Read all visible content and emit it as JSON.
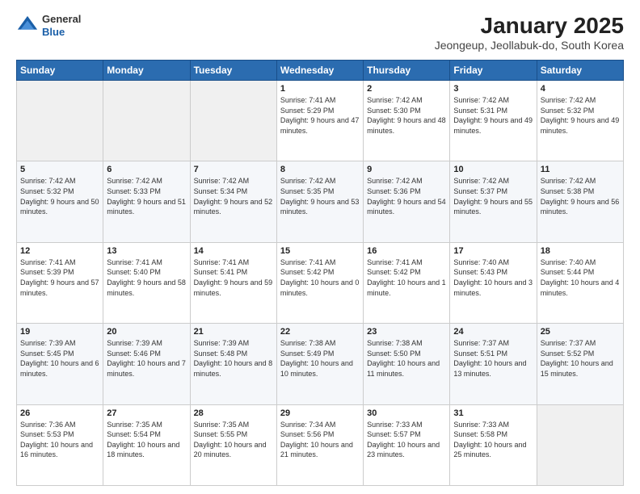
{
  "header": {
    "logo_general": "General",
    "logo_blue": "Blue",
    "title": "January 2025",
    "subtitle": "Jeongeup, Jeollabuk-do, South Korea"
  },
  "days_of_week": [
    "Sunday",
    "Monday",
    "Tuesday",
    "Wednesday",
    "Thursday",
    "Friday",
    "Saturday"
  ],
  "weeks": [
    [
      {
        "day": "",
        "info": ""
      },
      {
        "day": "",
        "info": ""
      },
      {
        "day": "",
        "info": ""
      },
      {
        "day": "1",
        "info": "Sunrise: 7:41 AM\nSunset: 5:29 PM\nDaylight: 9 hours and 47 minutes."
      },
      {
        "day": "2",
        "info": "Sunrise: 7:42 AM\nSunset: 5:30 PM\nDaylight: 9 hours and 48 minutes."
      },
      {
        "day": "3",
        "info": "Sunrise: 7:42 AM\nSunset: 5:31 PM\nDaylight: 9 hours and 49 minutes."
      },
      {
        "day": "4",
        "info": "Sunrise: 7:42 AM\nSunset: 5:32 PM\nDaylight: 9 hours and 49 minutes."
      }
    ],
    [
      {
        "day": "5",
        "info": "Sunrise: 7:42 AM\nSunset: 5:32 PM\nDaylight: 9 hours and 50 minutes."
      },
      {
        "day": "6",
        "info": "Sunrise: 7:42 AM\nSunset: 5:33 PM\nDaylight: 9 hours and 51 minutes."
      },
      {
        "day": "7",
        "info": "Sunrise: 7:42 AM\nSunset: 5:34 PM\nDaylight: 9 hours and 52 minutes."
      },
      {
        "day": "8",
        "info": "Sunrise: 7:42 AM\nSunset: 5:35 PM\nDaylight: 9 hours and 53 minutes."
      },
      {
        "day": "9",
        "info": "Sunrise: 7:42 AM\nSunset: 5:36 PM\nDaylight: 9 hours and 54 minutes."
      },
      {
        "day": "10",
        "info": "Sunrise: 7:42 AM\nSunset: 5:37 PM\nDaylight: 9 hours and 55 minutes."
      },
      {
        "day": "11",
        "info": "Sunrise: 7:42 AM\nSunset: 5:38 PM\nDaylight: 9 hours and 56 minutes."
      }
    ],
    [
      {
        "day": "12",
        "info": "Sunrise: 7:41 AM\nSunset: 5:39 PM\nDaylight: 9 hours and 57 minutes."
      },
      {
        "day": "13",
        "info": "Sunrise: 7:41 AM\nSunset: 5:40 PM\nDaylight: 9 hours and 58 minutes."
      },
      {
        "day": "14",
        "info": "Sunrise: 7:41 AM\nSunset: 5:41 PM\nDaylight: 9 hours and 59 minutes."
      },
      {
        "day": "15",
        "info": "Sunrise: 7:41 AM\nSunset: 5:42 PM\nDaylight: 10 hours and 0 minutes."
      },
      {
        "day": "16",
        "info": "Sunrise: 7:41 AM\nSunset: 5:42 PM\nDaylight: 10 hours and 1 minute."
      },
      {
        "day": "17",
        "info": "Sunrise: 7:40 AM\nSunset: 5:43 PM\nDaylight: 10 hours and 3 minutes."
      },
      {
        "day": "18",
        "info": "Sunrise: 7:40 AM\nSunset: 5:44 PM\nDaylight: 10 hours and 4 minutes."
      }
    ],
    [
      {
        "day": "19",
        "info": "Sunrise: 7:39 AM\nSunset: 5:45 PM\nDaylight: 10 hours and 6 minutes."
      },
      {
        "day": "20",
        "info": "Sunrise: 7:39 AM\nSunset: 5:46 PM\nDaylight: 10 hours and 7 minutes."
      },
      {
        "day": "21",
        "info": "Sunrise: 7:39 AM\nSunset: 5:48 PM\nDaylight: 10 hours and 8 minutes."
      },
      {
        "day": "22",
        "info": "Sunrise: 7:38 AM\nSunset: 5:49 PM\nDaylight: 10 hours and 10 minutes."
      },
      {
        "day": "23",
        "info": "Sunrise: 7:38 AM\nSunset: 5:50 PM\nDaylight: 10 hours and 11 minutes."
      },
      {
        "day": "24",
        "info": "Sunrise: 7:37 AM\nSunset: 5:51 PM\nDaylight: 10 hours and 13 minutes."
      },
      {
        "day": "25",
        "info": "Sunrise: 7:37 AM\nSunset: 5:52 PM\nDaylight: 10 hours and 15 minutes."
      }
    ],
    [
      {
        "day": "26",
        "info": "Sunrise: 7:36 AM\nSunset: 5:53 PM\nDaylight: 10 hours and 16 minutes."
      },
      {
        "day": "27",
        "info": "Sunrise: 7:35 AM\nSunset: 5:54 PM\nDaylight: 10 hours and 18 minutes."
      },
      {
        "day": "28",
        "info": "Sunrise: 7:35 AM\nSunset: 5:55 PM\nDaylight: 10 hours and 20 minutes."
      },
      {
        "day": "29",
        "info": "Sunrise: 7:34 AM\nSunset: 5:56 PM\nDaylight: 10 hours and 21 minutes."
      },
      {
        "day": "30",
        "info": "Sunrise: 7:33 AM\nSunset: 5:57 PM\nDaylight: 10 hours and 23 minutes."
      },
      {
        "day": "31",
        "info": "Sunrise: 7:33 AM\nSunset: 5:58 PM\nDaylight: 10 hours and 25 minutes."
      },
      {
        "day": "",
        "info": ""
      }
    ]
  ]
}
